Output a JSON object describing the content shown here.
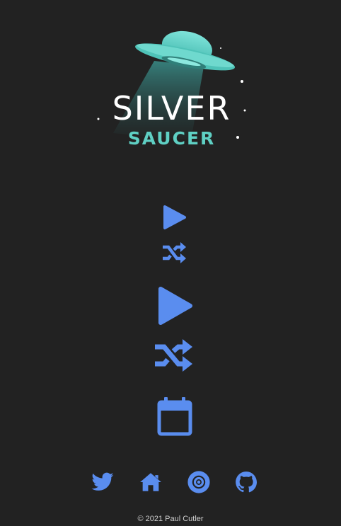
{
  "brand": {
    "title": "SILVER",
    "subtitle": "SAUCER",
    "accent_color": "#5fd0c4"
  },
  "controls": {
    "icon_color": "#5a8def",
    "items": [
      {
        "icon": "play-icon",
        "action": "play"
      },
      {
        "icon": "shuffle-icon",
        "action": "shuffle"
      },
      {
        "icon": "play-icon",
        "action": "play"
      },
      {
        "icon": "shuffle-icon",
        "action": "shuffle"
      },
      {
        "icon": "calendar-icon",
        "action": "calendar"
      }
    ]
  },
  "social_links": [
    {
      "icon": "twitter-icon"
    },
    {
      "icon": "home-icon"
    },
    {
      "icon": "podcast-icon"
    },
    {
      "icon": "github-icon"
    }
  ],
  "footer": {
    "text": "© 2021 Paul Cutler"
  }
}
